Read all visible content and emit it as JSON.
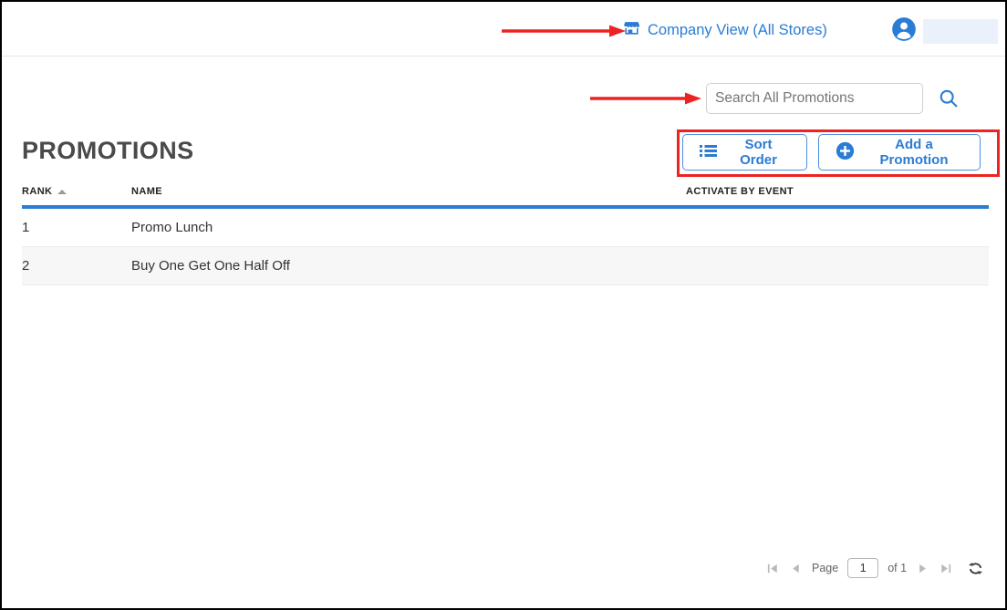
{
  "header": {
    "company_view_label": "Company View (All Stores)",
    "store_icon": "storefront-icon",
    "avatar_icon": "user-avatar-icon",
    "user_name": ""
  },
  "search": {
    "placeholder": "Search All Promotions",
    "value": "",
    "search_icon": "search-icon"
  },
  "main": {
    "title": "PROMOTIONS",
    "buttons": {
      "sort_order_label": "Sort Order",
      "sort_order_icon": "list-icon",
      "add_promotion_label": "Add a Promotion",
      "add_promotion_icon": "plus-circle-icon"
    }
  },
  "table": {
    "columns": [
      {
        "key": "rank",
        "label": "RANK",
        "sorted": "asc"
      },
      {
        "key": "name",
        "label": "NAME",
        "sorted": ""
      },
      {
        "key": "event",
        "label": "ACTIVATE BY EVENT",
        "sorted": ""
      }
    ],
    "rows": [
      {
        "rank": "1",
        "name": "Promo Lunch",
        "event": ""
      },
      {
        "rank": "2",
        "name": "Buy One Get One Half Off",
        "event": ""
      }
    ]
  },
  "pager": {
    "first_icon": "first-page-icon",
    "prev_icon": "prev-page-icon",
    "page_label": "Page",
    "page_value": "1",
    "of_label": "of 1",
    "next_icon": "next-page-icon",
    "last_icon": "last-page-icon",
    "refresh_icon": "refresh-icon"
  },
  "colors": {
    "accent_blue": "#2a7cd4",
    "header_rule_blue": "#2a7cd4",
    "annotation_red": "#ee2222",
    "title_gray": "#4a4a4a",
    "alt_row_gray": "#f7f7f7"
  }
}
